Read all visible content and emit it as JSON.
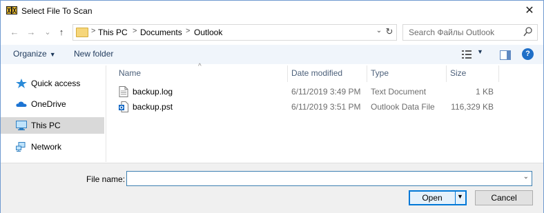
{
  "window": {
    "title": "Select File To Scan"
  },
  "nav": {
    "back": "←",
    "forward": "→",
    "recent": "⌄",
    "up": "↑"
  },
  "address": {
    "crumbs": [
      "This PC",
      "Documents",
      "Outlook"
    ],
    "separator": ">",
    "dropdown": "⌄",
    "refresh": "↻"
  },
  "search": {
    "placeholder": "Search Файлы Outlook"
  },
  "toolbar": {
    "organize": "Organize",
    "new_folder": "New folder",
    "help": "?"
  },
  "sidebar": {
    "items": [
      {
        "label": "Quick access",
        "icon": "star-icon"
      },
      {
        "label": "OneDrive",
        "icon": "cloud-icon"
      },
      {
        "label": "This PC",
        "icon": "computer-icon",
        "selected": true
      },
      {
        "label": "Network",
        "icon": "network-icon"
      }
    ]
  },
  "columns": {
    "name": "Name",
    "date": "Date modified",
    "type": "Type",
    "size": "Size"
  },
  "files": [
    {
      "name": "backup.log",
      "date": "6/11/2019 3:49 PM",
      "type": "Text Document",
      "size": "1 KB",
      "icon": "text-file-icon"
    },
    {
      "name": "backup.pst",
      "date": "6/11/2019 3:51 PM",
      "type": "Outlook Data File",
      "size": "116,329 KB",
      "icon": "outlook-file-icon"
    }
  ],
  "footer": {
    "file_name_label": "File name:",
    "file_name_value": "",
    "open": "Open",
    "cancel": "Cancel"
  },
  "colors": {
    "accent": "#0078d7",
    "toolbar_bg": "#f0f5fb",
    "selected_bg": "#d9d9d9"
  }
}
